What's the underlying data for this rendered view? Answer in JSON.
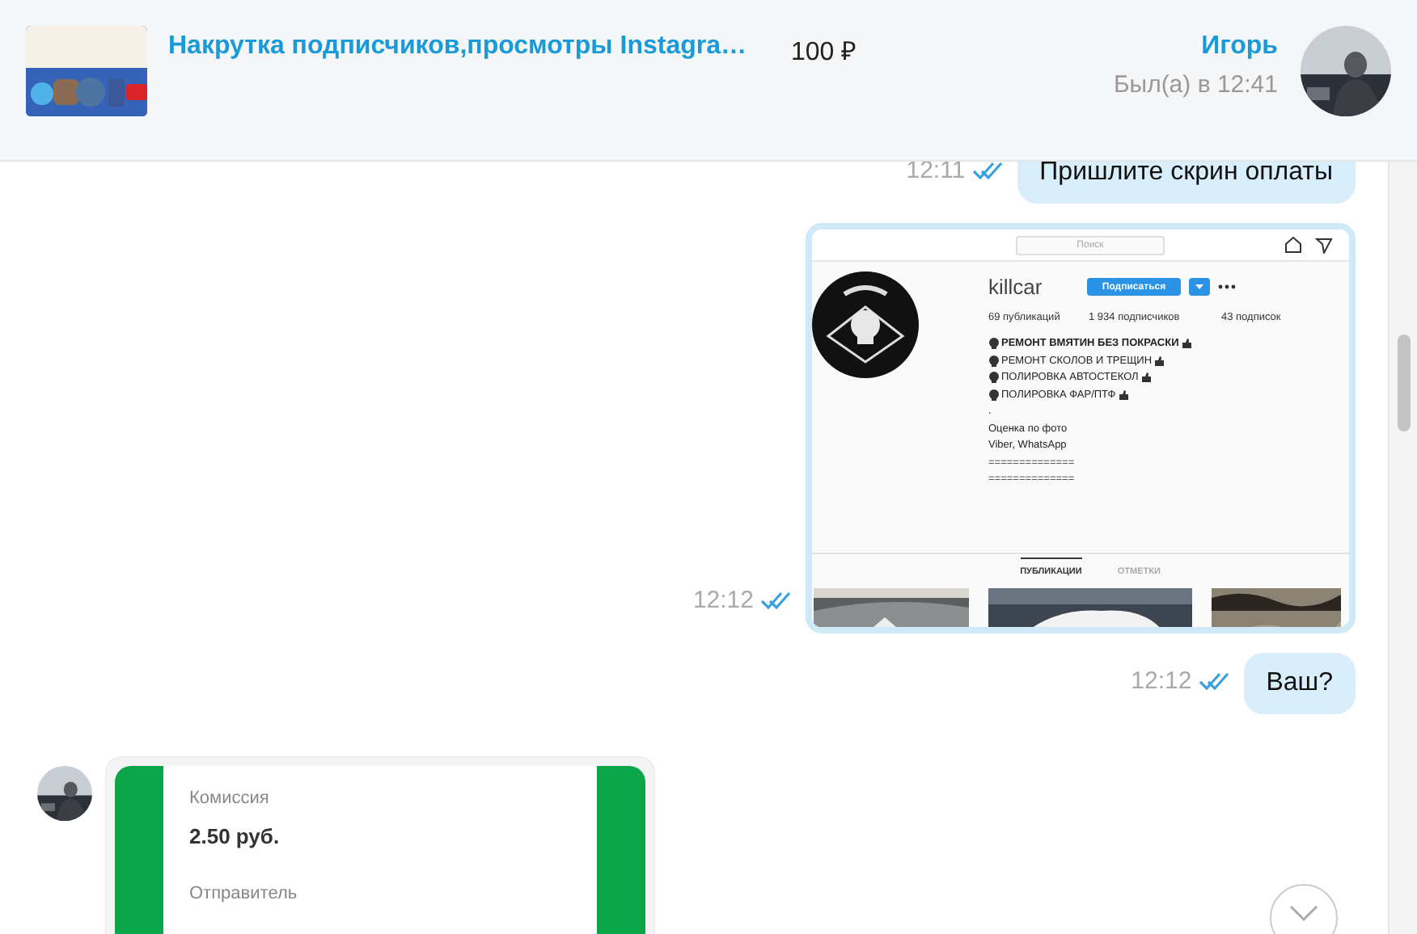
{
  "header": {
    "listing_title": "Накрутка подписчиков,просмотры Instagra…",
    "price": "100 ₽",
    "contact_name": "Игорь",
    "last_seen": "Был(а) в 12:41"
  },
  "messages": [
    {
      "kind": "text",
      "outgoing": true,
      "time": "12:11",
      "read": true,
      "text": "Пришлите скрин оплаты"
    },
    {
      "kind": "instagram_screenshot",
      "outgoing": true,
      "time": "12:12",
      "read": true,
      "screenshot": {
        "search_placeholder": "Поиск",
        "username": "killcar",
        "follow_button": "Подписаться",
        "stats": [
          "69 публикаций",
          "1 934 подписчиков",
          "43 подписок"
        ],
        "bio": [
          {
            "text": "РЕМОНТ ВМЯТИН БЕЗ ПОКРАСКИ",
            "emoji": true
          },
          {
            "text": "РЕМОНТ СКОЛОВ И ТРЕЩИН",
            "emoji": true
          },
          {
            "text": "ПОЛИРОВКА АВТОСТЕКОЛ",
            "emoji": true
          },
          {
            "text": "ПОЛИРОВКА ФАР/ПТФ",
            "emoji": true
          },
          {
            "text": ".",
            "emoji": false
          },
          {
            "text": "Оценка по фото",
            "emoji": false
          },
          {
            "text": "Viber, WhatsApp",
            "emoji": false
          },
          {
            "text": "==============",
            "emoji": false
          },
          {
            "text": "==============",
            "emoji": false
          }
        ],
        "tabs": [
          {
            "label": "ПУБЛИКАЦИИ",
            "selected": true
          },
          {
            "label": "ОТМЕТКИ",
            "selected": false
          }
        ]
      }
    },
    {
      "kind": "text",
      "outgoing": true,
      "time": "12:12",
      "read": true,
      "text": "Ваш?"
    },
    {
      "kind": "receipt",
      "outgoing": false,
      "fields": [
        {
          "label": "Комиссия",
          "value": "2.50 руб."
        },
        {
          "label": "Отправитель"
        }
      ]
    }
  ]
}
